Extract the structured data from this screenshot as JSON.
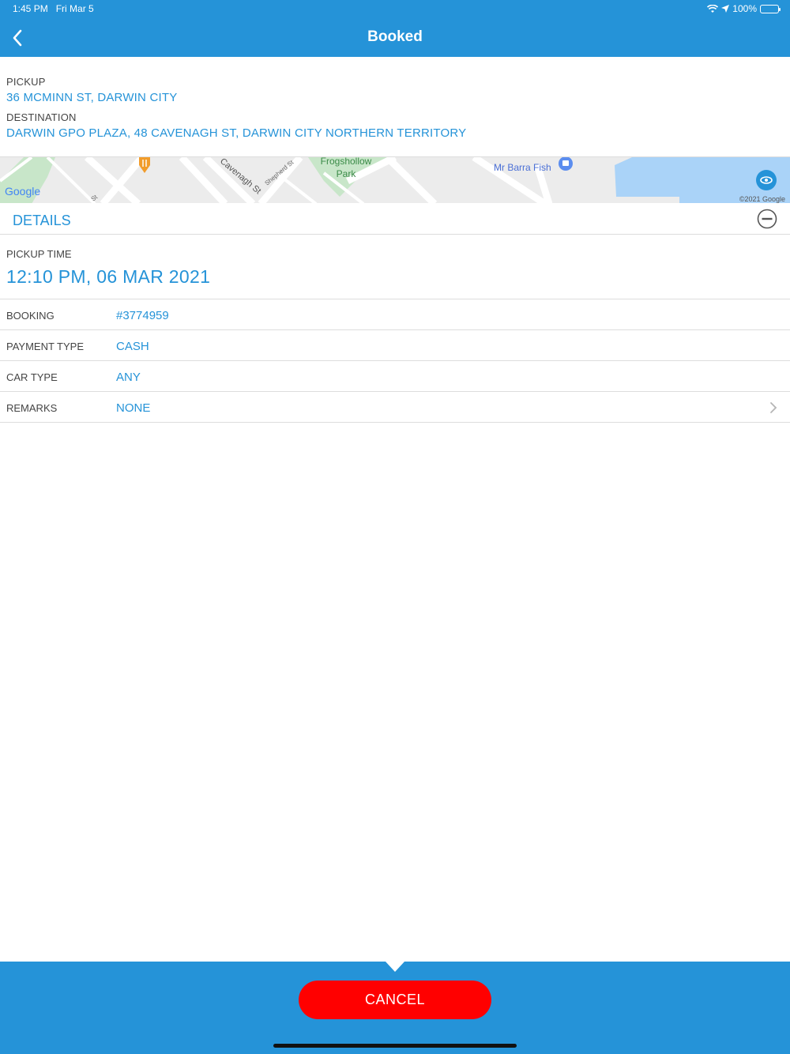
{
  "status_bar": {
    "time": "1:45 PM",
    "date": "Fri Mar 5",
    "battery": "100%",
    "battery_level": 1.0
  },
  "nav": {
    "title": "Booked"
  },
  "pickup": {
    "label": "PICKUP",
    "address": "36 MCMINN ST, DARWIN CITY"
  },
  "destination": {
    "label": "DESTINATION",
    "address": "DARWIN GPO PLAZA, 48 CAVENAGH ST, DARWIN CITY  NORTHERN TERRITORY"
  },
  "map": {
    "labels": {
      "park": "Frogshollow",
      "park2": "Park",
      "poi": "Mr Barra Fish",
      "street1": "Cavenagh St",
      "street2": "Shepherd St",
      "street3": "St",
      "logo": "Google",
      "copyright": "©2021 Google"
    },
    "colors": {
      "land": "#ececec",
      "water": "#aad3f8",
      "park": "#c8e6c9",
      "accent": "#2593d8"
    }
  },
  "details": {
    "title": "DETAILS",
    "pickup_time_label": "PICKUP TIME",
    "pickup_time": "12:10 PM, 06 MAR 2021",
    "rows": [
      {
        "key": "BOOKING",
        "value": "#3774959"
      },
      {
        "key": "PAYMENT TYPE",
        "value": "CASH"
      },
      {
        "key": "CAR TYPE",
        "value": "ANY"
      },
      {
        "key": "REMARKS",
        "value": "NONE"
      }
    ]
  },
  "footer": {
    "cancel_label": "CANCEL"
  },
  "colors": {
    "primary": "#2593d8",
    "danger": "#ff0000"
  }
}
